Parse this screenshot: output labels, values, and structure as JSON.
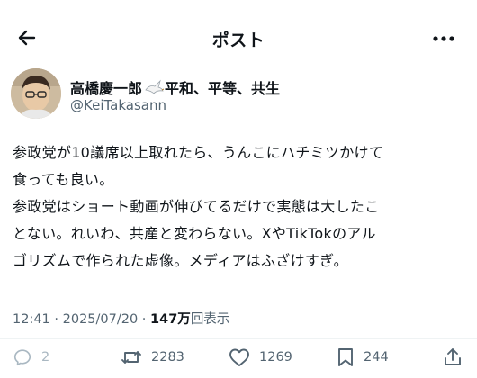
{
  "header": {
    "title": "ポスト"
  },
  "author": {
    "name_part1": "高橋慶一郎",
    "name_part2": "平和、平等、共生",
    "handle": "@KeiTakasann"
  },
  "tweet": {
    "text": "参政党が10議席以上取れたら、うんこにハチミツかけて\n食っても良い。\n参政党はショート動画が伸びてるだけで実態は大したこ\nとない。れいわ、共産と変わらない。XやTikTokのアル\nゴリズムで作られた虚像。メディアはふざけすぎ。"
  },
  "meta": {
    "time": "12:41",
    "separator": " · ",
    "date": "2025/07/20",
    "views_num": "147万",
    "views_label": "回表示"
  },
  "actions": {
    "replies": "2",
    "reposts": "2283",
    "likes": "1269",
    "bookmarks": "244"
  },
  "icons": {
    "back": "arrow-left-icon",
    "more": "more-dots-icon",
    "dove": "dove-icon",
    "reply": "reply-bubble-icon",
    "repost": "repost-icon",
    "like": "heart-icon",
    "bookmark": "bookmark-icon"
  }
}
